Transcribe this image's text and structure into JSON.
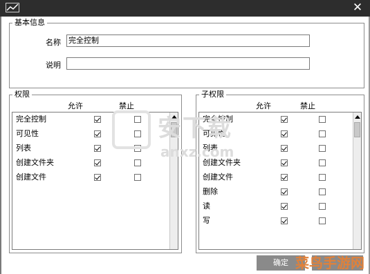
{
  "window": {
    "close_glyph": "✕"
  },
  "basic_info": {
    "legend": "基本信息",
    "name_label": "名称",
    "name_value": "完全控制",
    "desc_label": "说明",
    "desc_value": ""
  },
  "permissions": {
    "legend": "权限",
    "allow_header": "允许",
    "deny_header": "禁止",
    "rows": [
      {
        "name": "完全控制",
        "allow": true,
        "deny": false
      },
      {
        "name": "可见性",
        "allow": true,
        "deny": false
      },
      {
        "name": "列表",
        "allow": true,
        "deny": false
      },
      {
        "name": "创建文件夹",
        "allow": true,
        "deny": false
      },
      {
        "name": "创建文件",
        "allow": true,
        "deny": false
      }
    ]
  },
  "sub_permissions": {
    "legend": "子权限",
    "allow_header": "允许",
    "deny_header": "禁止",
    "rows": [
      {
        "name": "完全控制",
        "allow": true,
        "deny": false
      },
      {
        "name": "可见性",
        "allow": true,
        "deny": false
      },
      {
        "name": "列表",
        "allow": true,
        "deny": false
      },
      {
        "name": "创建文件夹",
        "allow": true,
        "deny": false
      },
      {
        "name": "创建文件",
        "allow": true,
        "deny": false
      },
      {
        "name": "删除",
        "allow": true,
        "deny": false
      },
      {
        "name": "读",
        "allow": true,
        "deny": false
      },
      {
        "name": "写",
        "allow": true,
        "deny": false
      }
    ]
  },
  "buttons": {
    "ok": "确定"
  },
  "watermark": {
    "brand": "安下载",
    "domain": "anxz.com",
    "corner": "菜鸟手游网"
  },
  "colors": {
    "titlebar": "#2d2d2d",
    "button": "#8a8a8a",
    "corner_watermark": "#e0813a"
  }
}
